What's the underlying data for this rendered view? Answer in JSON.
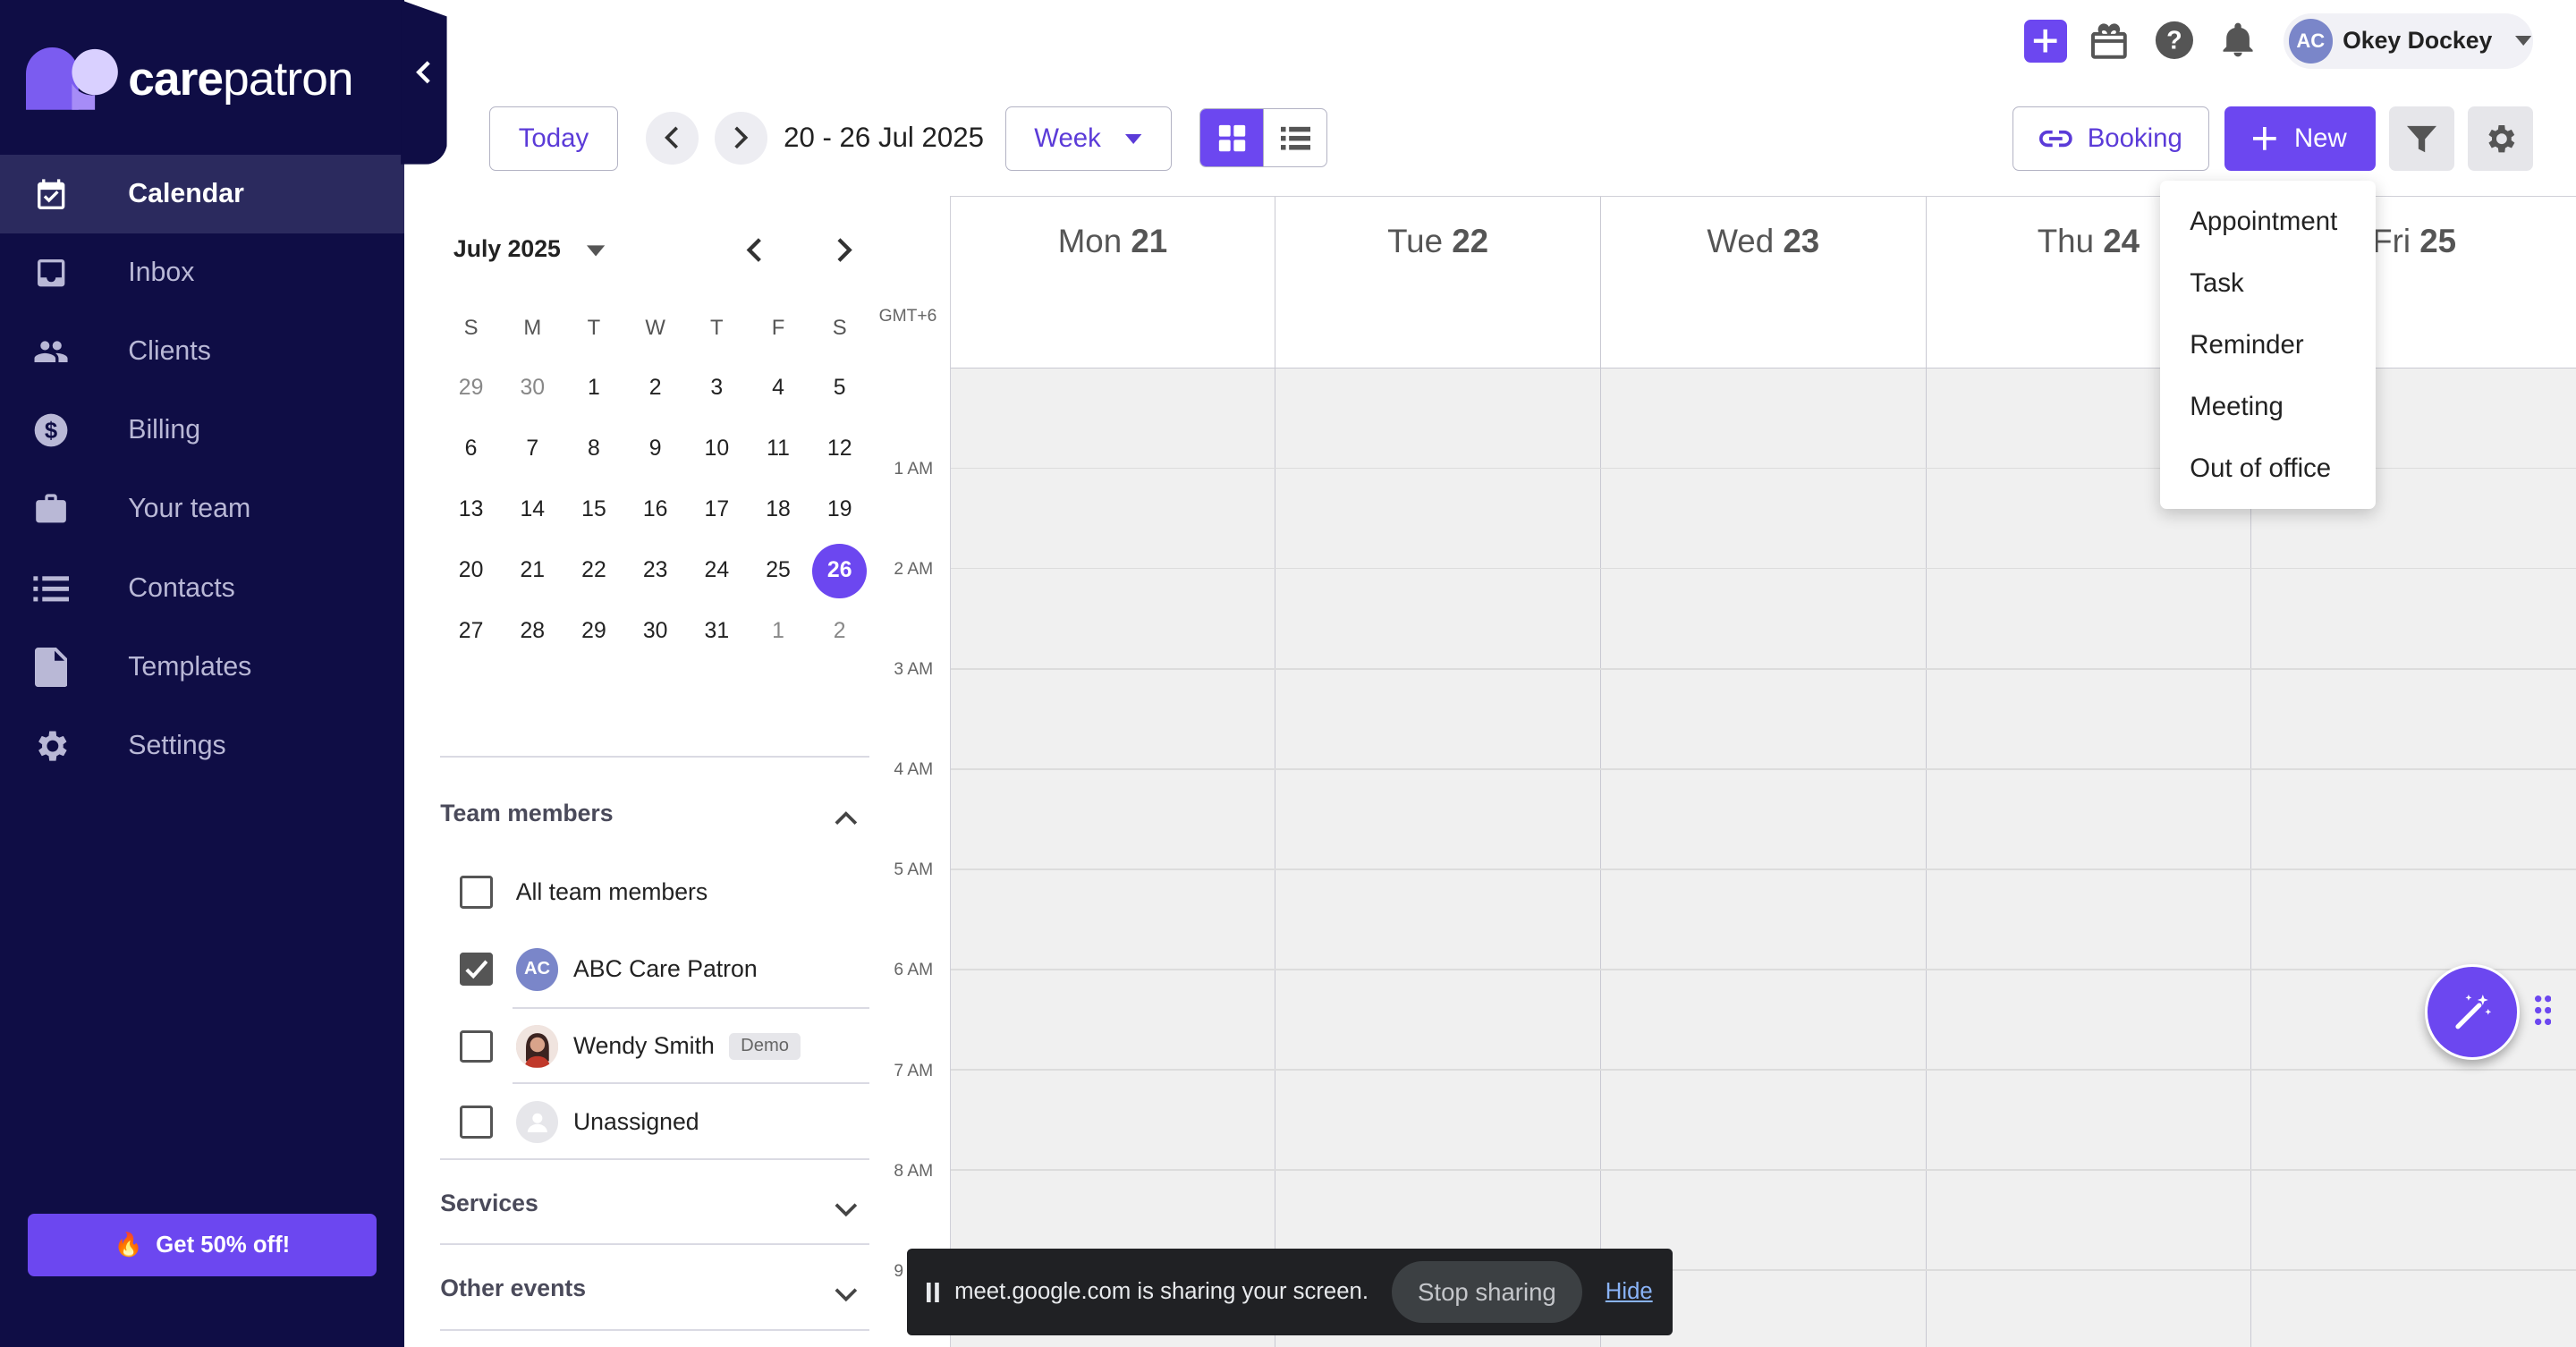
{
  "brand": {
    "logo_text_bold": "care",
    "logo_text": "patron"
  },
  "sidebar": {
    "items": [
      {
        "label": "Calendar",
        "icon": "calendar-icon"
      },
      {
        "label": "Inbox",
        "icon": "inbox-icon"
      },
      {
        "label": "Clients",
        "icon": "people-icon"
      },
      {
        "label": "Billing",
        "icon": "dollar-icon"
      },
      {
        "label": "Your team",
        "icon": "briefcase-icon"
      },
      {
        "label": "Contacts",
        "icon": "list-icon"
      },
      {
        "label": "Templates",
        "icon": "document-icon"
      },
      {
        "label": "Settings",
        "icon": "gear-icon"
      }
    ],
    "promo_icon": "🔥",
    "promo_label": "Get 50% off!"
  },
  "header": {
    "user_initials": "AC",
    "user_name": "Okey Dockey"
  },
  "toolbar": {
    "today_label": "Today",
    "date_range": "20 - 26 Jul 2025",
    "view_select": "Week",
    "booking_label": "Booking",
    "new_label": "New"
  },
  "mini_calendar": {
    "month_label": "July 2025",
    "weekdays": [
      "S",
      "M",
      "T",
      "W",
      "T",
      "F",
      "S"
    ],
    "weeks": [
      [
        "29",
        "30",
        "1",
        "2",
        "3",
        "4",
        "5"
      ],
      [
        "6",
        "7",
        "8",
        "9",
        "10",
        "11",
        "12"
      ],
      [
        "13",
        "14",
        "15",
        "16",
        "17",
        "18",
        "19"
      ],
      [
        "20",
        "21",
        "22",
        "23",
        "24",
        "25",
        "26"
      ],
      [
        "27",
        "28",
        "29",
        "30",
        "31",
        "1",
        "2"
      ]
    ],
    "selected": "26"
  },
  "team_members": {
    "title": "Team members",
    "all_label": "All team members",
    "members": [
      {
        "initials": "AC",
        "name": "ABC Care Patron",
        "checked": true
      },
      {
        "initials": "",
        "name": "Wendy Smith",
        "badge": "Demo",
        "checked": false
      },
      {
        "initials": "",
        "name": "Unassigned",
        "checked": false
      }
    ]
  },
  "sections": {
    "services": "Services",
    "other_events": "Other events"
  },
  "calendar": {
    "timezone": "GMT+6",
    "days": [
      {
        "name": "Mon",
        "num": "21"
      },
      {
        "name": "Tue",
        "num": "22"
      },
      {
        "name": "Wed",
        "num": "23"
      },
      {
        "name": "Thu",
        "num": "24"
      },
      {
        "name": "Fri",
        "num": "25"
      }
    ],
    "hours": [
      "1 AM",
      "2 AM",
      "3 AM",
      "4 AM",
      "5 AM",
      "6 AM",
      "7 AM",
      "8 AM",
      "9 AM"
    ]
  },
  "new_menu": {
    "items": [
      "Appointment",
      "Task",
      "Reminder",
      "Meeting",
      "Out of office"
    ]
  },
  "screen_share": {
    "message": "meet.google.com is sharing your screen.",
    "stop_label": "Stop sharing",
    "hide_label": "Hide"
  },
  "colors": {
    "sidebar_bg": "#0f0d45",
    "accent": "#6c47f0",
    "grid_bg": "#f0f0f0"
  }
}
